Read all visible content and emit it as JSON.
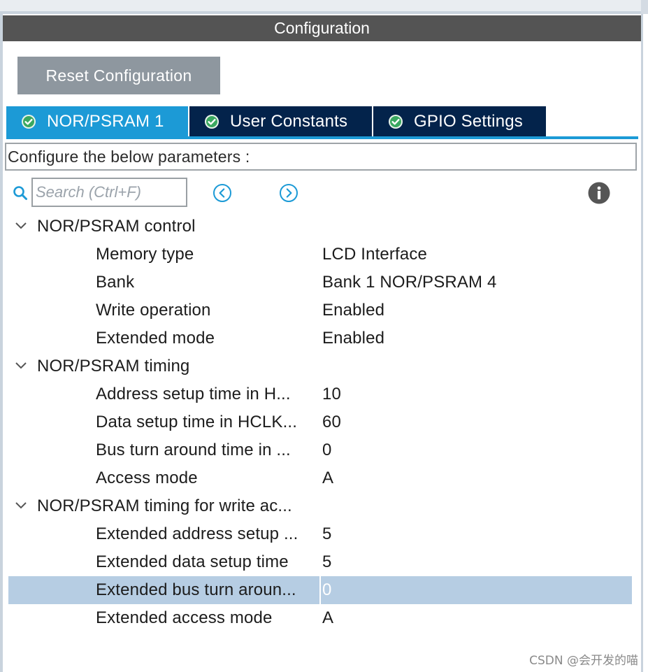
{
  "panel": {
    "title": "Configuration"
  },
  "reset_label": "Reset Configuration",
  "tabs": [
    {
      "label": "NOR/PSRAM 1",
      "active": true,
      "icon": "check-circle-icon"
    },
    {
      "label": "User Constants",
      "active": false,
      "icon": "check-circle-icon"
    },
    {
      "label": "GPIO Settings",
      "active": false,
      "icon": "check-circle-icon"
    }
  ],
  "params_hint": "Configure the below parameters :",
  "search": {
    "placeholder": "Search (Ctrl+F)",
    "value": ""
  },
  "groups": [
    {
      "label": "NOR/PSRAM control",
      "items": [
        {
          "label": "Memory type",
          "value": "LCD Interface"
        },
        {
          "label": "Bank",
          "value": "Bank 1 NOR/PSRAM 4"
        },
        {
          "label": "Write operation",
          "value": "Enabled"
        },
        {
          "label": "Extended mode",
          "value": "Enabled"
        }
      ]
    },
    {
      "label": "NOR/PSRAM timing",
      "items": [
        {
          "label": "Address setup time in H...",
          "value": "10"
        },
        {
          "label": "Data setup time in HCLK...",
          "value": "60"
        },
        {
          "label": "Bus turn around time in ...",
          "value": "0"
        },
        {
          "label": "Access mode",
          "value": "A"
        }
      ]
    },
    {
      "label": "NOR/PSRAM timing for write ac...",
      "items": [
        {
          "label": "Extended address setup ...",
          "value": "5"
        },
        {
          "label": "Extended data setup time",
          "value": "5"
        },
        {
          "label": "Extended bus turn aroun...",
          "value": "0",
          "selected": true
        },
        {
          "label": "Extended access mode",
          "value": "A"
        }
      ]
    }
  ],
  "watermark": "CSDN @会开发的喵",
  "colors": {
    "header_bg": "#545454",
    "tab_active": "#1c9ad6",
    "tab_inactive": "#03234b",
    "button_bg": "#8e979f",
    "selection": "#b6cde3",
    "nav_icon": "#1c9ad6"
  }
}
